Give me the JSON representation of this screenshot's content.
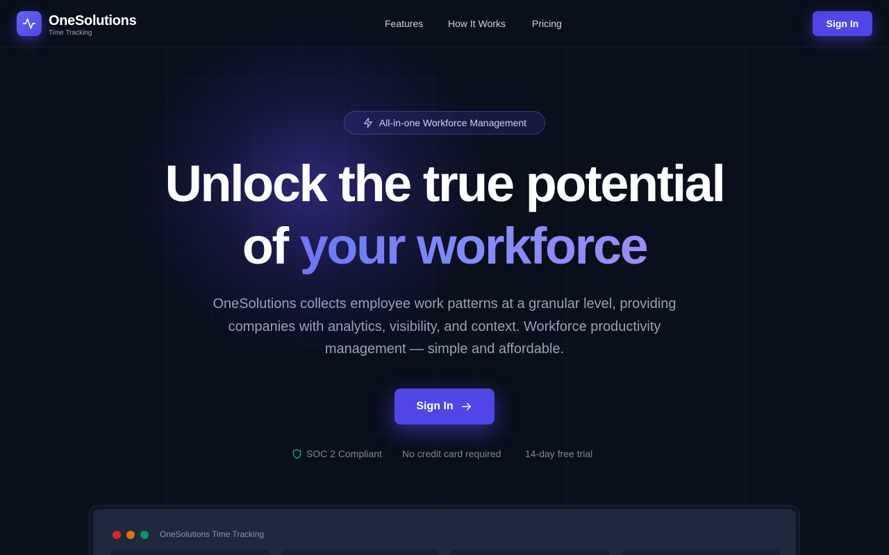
{
  "header": {
    "brand_name": "OneSolutions",
    "brand_sub": "Time Tracking",
    "logo_icon": "activity-icon",
    "nav": [
      {
        "label": "Features"
      },
      {
        "label": "How It Works"
      },
      {
        "label": "Pricing"
      }
    ],
    "signin_label": "Sign In"
  },
  "hero": {
    "pill_icon": "lightning-icon",
    "pill_label": "All-in-one Workforce Management",
    "title_line1": "Unlock the true potential",
    "title_line2_plain": "of ",
    "title_line2_accent": "your workforce",
    "description": "OneSolutions collects employee work patterns at a granular level, providing companies with analytics, visibility, and context. Workforce productivity management — simple and affordable.",
    "cta_label": "Sign In",
    "cta_icon": "arrow-right-icon",
    "badges": [
      {
        "label": "SOC 2 Compliant",
        "icon": "shield-icon"
      },
      {
        "label": "No credit card required"
      },
      {
        "label": "14-day free trial"
      }
    ]
  },
  "preview": {
    "window_title": "OneSolutions Time Tracking"
  },
  "colors": {
    "background": "#0a0f1c",
    "accent": "#4f46e5",
    "accent_text": "#818cf8",
    "shield": "#10b981"
  }
}
